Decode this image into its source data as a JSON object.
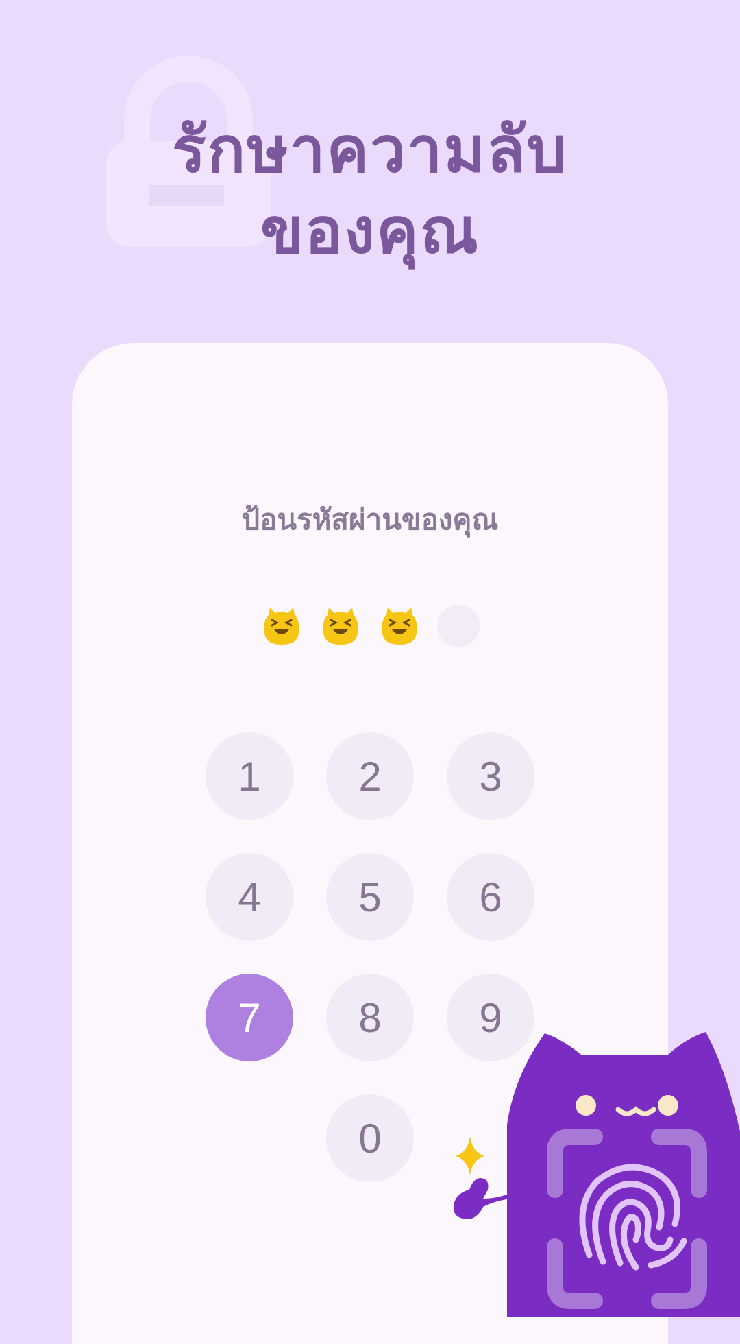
{
  "header": {
    "title_line1": "รักษาความลับ",
    "title_line2": "ของคุณ",
    "background_icon": "lock-icon"
  },
  "pin": {
    "prompt": "ป้อนรหัสผ่านของคุณ",
    "length": 4,
    "entered": 3,
    "filled_icon": "cat-face-icon"
  },
  "keypad": {
    "keys": [
      "1",
      "2",
      "3",
      "4",
      "5",
      "6",
      "7",
      "8",
      "9",
      "0"
    ],
    "active_key": "7"
  },
  "mascot": {
    "icons": [
      "cat-mascot-icon",
      "fingerprint-icon",
      "sparkle-icon"
    ]
  },
  "colors": {
    "background": "#EADAFB",
    "title": "#7B579C",
    "card": "#FBF7FD",
    "key": "#F0EBF6",
    "key_active": "#AE80E0",
    "mascot": "#7B2CC2",
    "cat_emoji": "#F7C513"
  }
}
